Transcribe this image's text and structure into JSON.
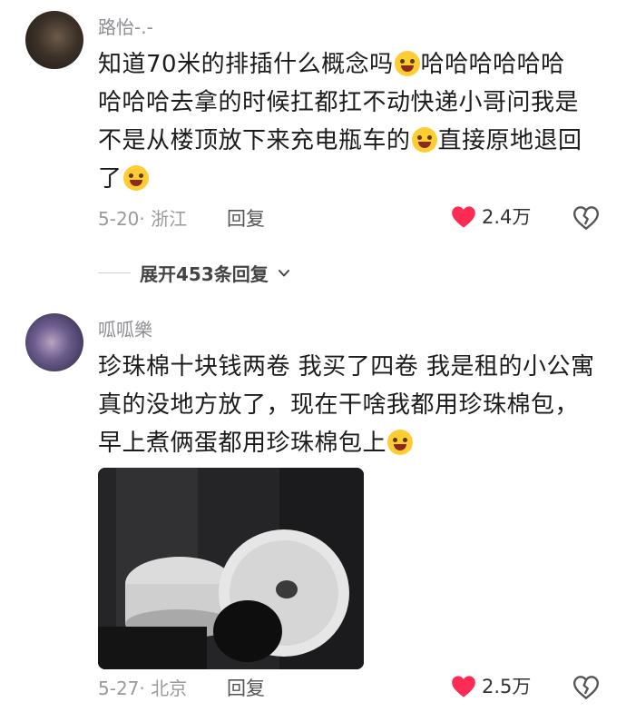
{
  "comments": [
    {
      "username": "路怡-.-",
      "lines": [
        "知道70米的排插什么概念吗",
        "哈哈哈哈哈哈",
        "哈哈哈去拿的时候扛都扛不动快递小哥问我是",
        "不是从楼顶放下来充电瓶车的",
        "直接原地退回",
        "了"
      ],
      "date_location": "5-20· 浙江",
      "reply_label": "回复",
      "like_count": "2.4万"
    },
    {
      "username": "呱呱樂",
      "lines": [
        "珍珠棉十块钱两卷 我买了四卷  我是租的小公寓",
        "真的没地方放了，现在干啥我都用珍珠棉包，",
        "早上煮俩蛋都用珍珠棉包上"
      ],
      "date_location": "5-27· 北京",
      "reply_label": "回复",
      "like_count": "2.5万"
    }
  ],
  "expand_replies": "展开453条回复",
  "icons": {
    "like": "heart-icon",
    "dislike": "broken-heart-icon",
    "expand": "chevron-down-icon",
    "emoji": "laughing-crying-emoji"
  },
  "colors": {
    "heart": "#fe2c55",
    "username": "#8e8e93",
    "meta": "#9a9a9a"
  }
}
